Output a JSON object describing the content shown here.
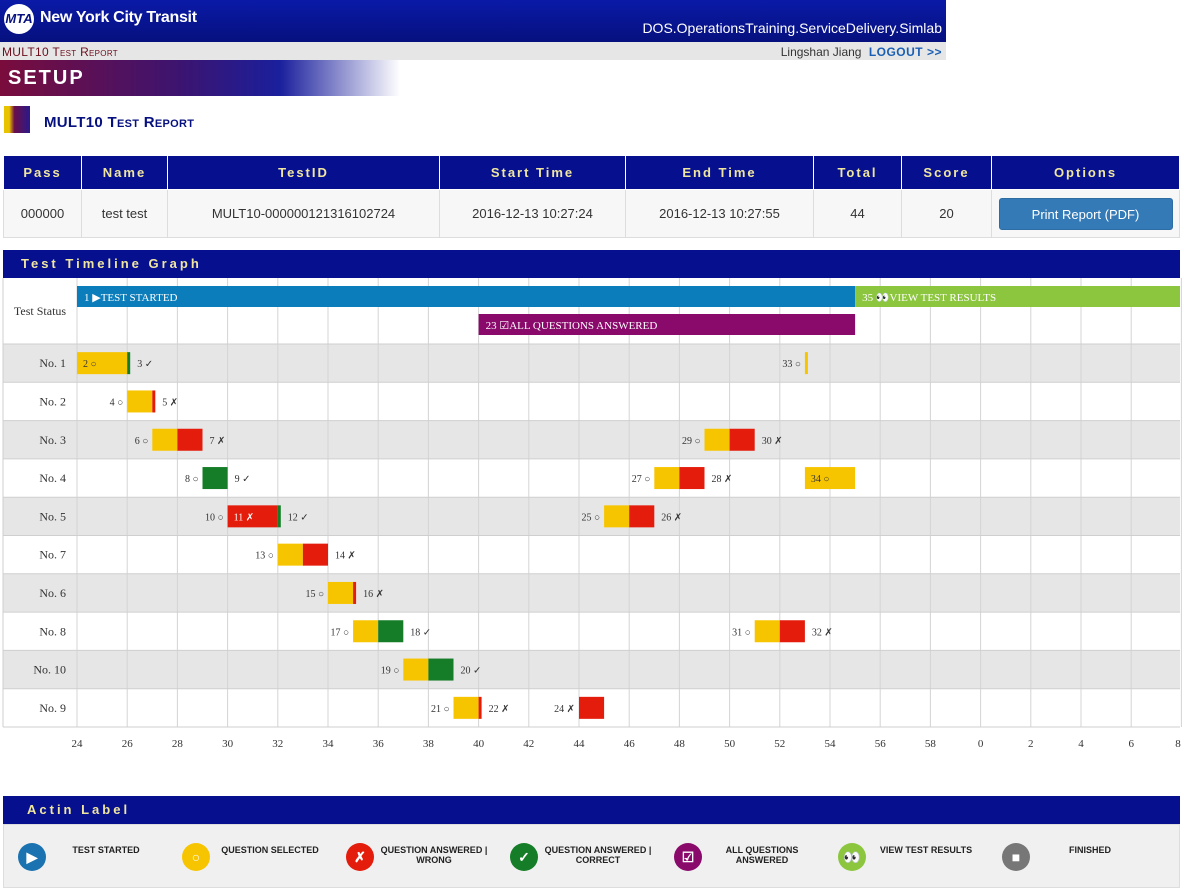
{
  "header": {
    "logo_text": "MTA",
    "brand": "New York City Transit",
    "system_name": "DOS.OperationsTraining.ServiceDelivery.Simlab",
    "page_name": "MULT10 Test Report",
    "user": "Lingshan Jiang",
    "logout": "LOGOUT >>",
    "setup": "SETUP",
    "section_title": "MULT10 Test Report"
  },
  "results": {
    "headers": [
      "Pass",
      "Name",
      "TestID",
      "Start Time",
      "End Time",
      "Total",
      "Score",
      "Options"
    ],
    "row": {
      "pass": "000000",
      "name": "test test",
      "test_id": "MULT10-000000121316102724",
      "start": "2016-12-13 10:27:24",
      "end": "2016-12-13 10:27:55",
      "total": "44",
      "score": "20",
      "print_label": "Print Report (PDF)"
    }
  },
  "timeline": {
    "title": "Test Timeline Graph",
    "status_label": "Test Status",
    "x_ticks": [
      "24",
      "26",
      "28",
      "30",
      "32",
      "34",
      "36",
      "38",
      "40",
      "42",
      "44",
      "46",
      "48",
      "50",
      "52",
      "54",
      "56",
      "58",
      "0",
      "2",
      "4",
      "6",
      "8"
    ],
    "colors": {
      "blue": "#0b7dbb",
      "yellow": "#f7c500",
      "red": "#e31c0c",
      "green": "#157d27",
      "purple": "#8a0a6c",
      "lime": "#8cc63f",
      "gray": "#777777"
    },
    "status_bars": [
      {
        "from": 24,
        "to": 55,
        "row": 0,
        "color": "blue",
        "label": "1 ▶TEST STARTED"
      },
      {
        "from": 55,
        "to": 68,
        "row": 0,
        "color": "lime",
        "label": "35 👀VIEW TEST RESULTS"
      },
      {
        "from": 40,
        "to": 55,
        "row": 1,
        "color": "purple",
        "label": "23 ☑ALL QUESTIONS ANSWERED"
      }
    ],
    "rows": [
      {
        "label": "No. 1",
        "segments": [
          {
            "from": 24,
            "to": 26,
            "color": "yellow",
            "text": "2 ○",
            "textIn": true
          },
          {
            "from": 26,
            "to": 26.1,
            "color": "green",
            "text": "3 ✓"
          },
          {
            "from": 53,
            "to": 53.1,
            "color": "yellow",
            "text": "33 ○",
            "textLeft": true
          }
        ]
      },
      {
        "label": "No. 2",
        "segments": [
          {
            "from": 26,
            "to": 27,
            "color": "yellow",
            "text": "4 ○",
            "textLeft": true
          },
          {
            "from": 27,
            "to": 27.1,
            "color": "red",
            "text": "5 ✗"
          }
        ]
      },
      {
        "label": "No. 3",
        "segments": [
          {
            "from": 27,
            "to": 28,
            "color": "yellow",
            "text": "6 ○",
            "textLeft": true
          },
          {
            "from": 28,
            "to": 29,
            "color": "red",
            "text": "7 ✗"
          },
          {
            "from": 49,
            "to": 50,
            "color": "yellow",
            "text": "29 ○",
            "textLeft": true
          },
          {
            "from": 50,
            "to": 51,
            "color": "red",
            "text": "30 ✗"
          }
        ]
      },
      {
        "label": "No. 4",
        "segments": [
          {
            "from": 29,
            "to": 30,
            "color": "green",
            "text": "9 ✓",
            "preText": "8 ○"
          },
          {
            "from": 47,
            "to": 48,
            "color": "yellow",
            "text": "27 ○",
            "textLeft": true
          },
          {
            "from": 48,
            "to": 49,
            "color": "red",
            "text": "28 ✗"
          },
          {
            "from": 53,
            "to": 55,
            "color": "yellow",
            "text": "34 ○",
            "textIn": true
          }
        ]
      },
      {
        "label": "No. 5",
        "segments": [
          {
            "from": 30,
            "to": 32,
            "color": "red",
            "text": "11 ✗",
            "textIn": true,
            "preText": "10 ○"
          },
          {
            "from": 32,
            "to": 32.1,
            "color": "green",
            "text": "12 ✓"
          },
          {
            "from": 45,
            "to": 46,
            "color": "yellow",
            "text": "25 ○",
            "textLeft": true
          },
          {
            "from": 46,
            "to": 47,
            "color": "red",
            "text": "26 ✗"
          }
        ]
      },
      {
        "label": "No. 7",
        "segments": [
          {
            "from": 32,
            "to": 33,
            "color": "yellow",
            "text": "13 ○",
            "textLeft": true
          },
          {
            "from": 33,
            "to": 34,
            "color": "red",
            "text": "14 ✗"
          }
        ]
      },
      {
        "label": "No. 6",
        "segments": [
          {
            "from": 34,
            "to": 35,
            "color": "yellow",
            "text": "15 ○",
            "textLeft": true
          },
          {
            "from": 35,
            "to": 35.1,
            "color": "red",
            "text": "16 ✗"
          }
        ]
      },
      {
        "label": "No. 8",
        "segments": [
          {
            "from": 35,
            "to": 36,
            "color": "yellow",
            "text": "17 ○",
            "textLeft": true
          },
          {
            "from": 36,
            "to": 37,
            "color": "green",
            "text": "18 ✓"
          },
          {
            "from": 51,
            "to": 52,
            "color": "yellow",
            "text": "31 ○",
            "textLeft": true
          },
          {
            "from": 52,
            "to": 53,
            "color": "red",
            "text": "32 ✗"
          }
        ]
      },
      {
        "label": "No. 10",
        "segments": [
          {
            "from": 37,
            "to": 38,
            "color": "yellow",
            "text": "19 ○",
            "textLeft": true
          },
          {
            "from": 38,
            "to": 39,
            "color": "green",
            "text": "20 ✓"
          }
        ]
      },
      {
        "label": "No. 9",
        "segments": [
          {
            "from": 39,
            "to": 40,
            "color": "yellow",
            "text": "21 ○",
            "textLeft": true
          },
          {
            "from": 40,
            "to": 40.1,
            "color": "red",
            "text": "22 ✗"
          },
          {
            "from": 44,
            "to": 45,
            "color": "red",
            "text": "24 ✗",
            "textLeft": true
          }
        ]
      }
    ]
  },
  "legend": {
    "title": "Actin Label",
    "items": [
      {
        "label": "TEST STARTED",
        "color": "#1a73b0",
        "glyph": "▶",
        "icon": "play-icon"
      },
      {
        "label": "QUESTION SELECTED",
        "color": "#f7c500",
        "glyph": "○",
        "icon": "circle-icon"
      },
      {
        "label": "QUESTION ANSWERED | WRONG",
        "color": "#e31c0c",
        "glyph": "✗",
        "icon": "cross-icon"
      },
      {
        "label": "QUESTION ANSWERED | CORRECT",
        "color": "#157d27",
        "glyph": "✓",
        "icon": "check-icon"
      },
      {
        "label": "ALL QUESTIONS ANSWERED",
        "color": "#8a0a6c",
        "glyph": "☑",
        "icon": "checkbox-icon"
      },
      {
        "label": "VIEW TEST RESULTS",
        "color": "#8cc63f",
        "glyph": "👀",
        "icon": "eyes-icon"
      },
      {
        "label": "FINISHED",
        "color": "#777777",
        "glyph": "■",
        "icon": "stop-icon"
      }
    ]
  }
}
